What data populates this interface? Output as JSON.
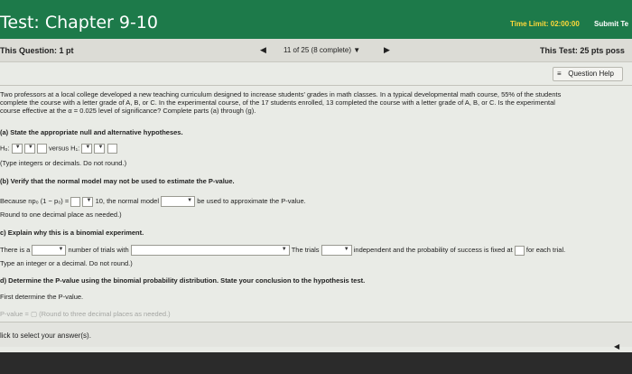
{
  "header": {
    "title": "Test: Chapter 9-10",
    "time_limit": "Time Limit: 02:00:00",
    "submit": "Submit Te"
  },
  "info": {
    "this_question": "This Question: 1 pt",
    "progress": "11 of 25 (8 complete)",
    "progress_caret": "▼",
    "prev": "◀",
    "next": "▶",
    "this_test": "This Test: 25 pts poss"
  },
  "help": {
    "label": "Question Help",
    "icon": "≡"
  },
  "problem": {
    "line1": "Two professors at a local college developed a new teaching curriculum designed to increase students' grades in math classes. In a typical developmental math course, 55% of the students",
    "line2": "complete the course with a letter grade of A, B, or C. In the experimental course, of the 17 students enrolled, 13 completed the course with a letter grade of A, B, or C. Is the experimental",
    "line3": "course effective at the α = 0.025 level of significance? Complete parts (a) through (g)."
  },
  "part_a": {
    "heading": "(a) State the appropriate null and alternative hypotheses.",
    "h0": "H₀:",
    "versus": "versus H₁:",
    "hint": "(Type integers or decimals. Do not round.)"
  },
  "part_b": {
    "heading": "(b) Verify that the normal model may not be used to estimate the P-value.",
    "because": "Because np₀ (1 − p₀) =",
    "ten": "10, the normal model",
    "be_used": "be used to approximate the P-value.",
    "hint": "Round to one decimal place as needed.)"
  },
  "part_c": {
    "heading": "c) Explain why this is a binomial experiment.",
    "there_is": "There is a",
    "number_of": "number of trials with",
    "the_trials": "The trials",
    "independent": "independent and the probability of success is fixed at",
    "each_trial": "for each trial.",
    "hint": "Type an integer or a decimal. Do not round.)"
  },
  "part_d": {
    "heading": "d) Determine the P-value using the binomial probability distribution. State your conclusion to the hypothesis test.",
    "first": "First determine the P-value.",
    "partial": "P-value = ▢ (Round to three decimal places as needed.)"
  },
  "bottom": {
    "click": "lick to select your answer(s).",
    "scroll_icon": "◀"
  }
}
